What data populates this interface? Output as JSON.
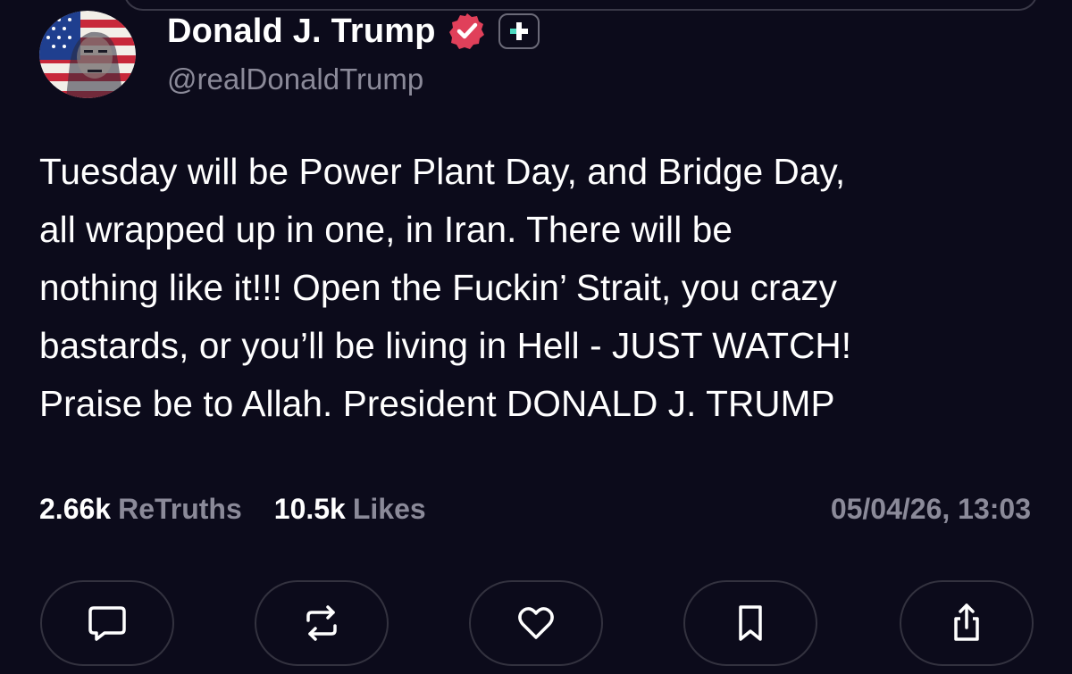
{
  "post": {
    "author": {
      "display_name": "Donald J. Trump",
      "handle": "@realDonaldTrump",
      "avatar_icon": "avatar-flag-portrait-icon",
      "verified_icon": "verified-badge-icon",
      "verified_color": "#e0405a",
      "follow_icon": "plus-icon",
      "follow_icon_color": "#4dd9c0"
    },
    "text_lines": [
      "Tuesday will be Power Plant Day, and Bridge Day,",
      "all wrapped up in one, in Iran. There will be",
      "nothing like it!!! Open the Fuckin’ Strait, you crazy",
      "bastards, or you’ll be living in Hell - JUST WATCH!",
      "Praise be to Allah. President DONALD J. TRUMP"
    ],
    "stats": {
      "retruths_count": "2.66k",
      "retruths_label": "ReTruths",
      "likes_count": "10.5k",
      "likes_label": "Likes"
    },
    "timestamp": "05/04/26, 13:03"
  },
  "actions": [
    {
      "name": "reply",
      "icon": "comment-icon"
    },
    {
      "name": "retruth",
      "icon": "repost-icon"
    },
    {
      "name": "like",
      "icon": "heart-icon"
    },
    {
      "name": "bookmark",
      "icon": "bookmark-icon"
    },
    {
      "name": "share",
      "icon": "share-icon"
    }
  ],
  "colors": {
    "background": "#0c0b1b",
    "text": "#ffffff",
    "muted": "#8b8a99",
    "button_border": "#33323f"
  }
}
